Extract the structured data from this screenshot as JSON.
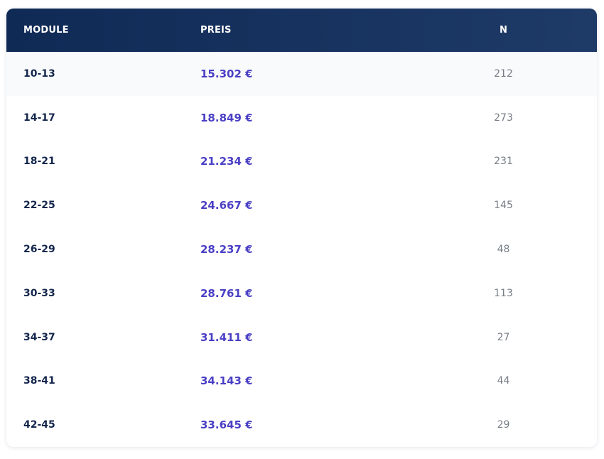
{
  "table": {
    "headers": {
      "module": "MODULE",
      "price": "PREIS",
      "n": "N"
    },
    "rows": [
      {
        "module": "10-13",
        "price": "15.302 €",
        "n": "212"
      },
      {
        "module": "14-17",
        "price": "18.849 €",
        "n": "273"
      },
      {
        "module": "18-21",
        "price": "21.234 €",
        "n": "231"
      },
      {
        "module": "22-25",
        "price": "24.667 €",
        "n": "145"
      },
      {
        "module": "26-29",
        "price": "28.237 €",
        "n": "48"
      },
      {
        "module": "30-33",
        "price": "28.761 €",
        "n": "113"
      },
      {
        "module": "34-37",
        "price": "31.411 €",
        "n": "27"
      },
      {
        "module": "38-41",
        "price": "34.143 €",
        "n": "44"
      },
      {
        "module": "42-45",
        "price": "33.645 €",
        "n": "29"
      }
    ]
  },
  "colors": {
    "header_bg": "#102a56",
    "module_text": "#14264d",
    "price_text": "#4a3fc4",
    "n_text": "#777d86",
    "alt_row_bg": "#f9fafb"
  }
}
